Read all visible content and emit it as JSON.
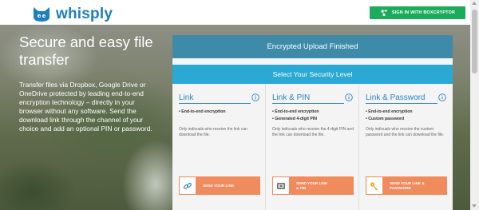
{
  "header": {
    "logo_text": "whisply",
    "signin_label": "SIGN IN WITH BOXCRYPTOR"
  },
  "hero": {
    "title": "Secure and easy file transfer",
    "text": "Transfer files via Dropbox, Google Drive or OneDrive protected by leading end-to-end encryption technology – directly in your browser without any software. Send the download link through the channel of your choice and add an optional PIN or password."
  },
  "panel": {
    "status": "Encrypted Upload Finished",
    "select_heading": "Select Your Security Level",
    "cards": [
      {
        "title": "Link",
        "features": [
          "End-to-end encryption"
        ],
        "description": "Only indivuals who receive the link can download the file.",
        "button_label": "SEND YOUR LINK",
        "icon": "link-icon"
      },
      {
        "title": "Link & PIN",
        "features": [
          "End-to-end encryption",
          "Generated 4-digit PIN"
        ],
        "description": "Only indivuals who receive the 4-digit PIN and the link can download the file.",
        "button_label": "SEND YOUR LINK & PIN",
        "icon": "pin-pad-icon"
      },
      {
        "title": "Link & Password",
        "features": [
          "End-to-end encryption",
          "Custom password"
        ],
        "description": "Only indivuals who receive the custom password and the link can download the file.",
        "button_label": "SEND YOUR LINK & PASSWORD",
        "icon": "key-icon"
      }
    ]
  },
  "colors": {
    "brand": "#1d7fbd",
    "signin_green": "#1cab5b",
    "status_bar": "#3d8ba8",
    "select_bar": "#29a9d4",
    "card_title": "#2a84c4",
    "send_button": "#ef8b5c"
  }
}
